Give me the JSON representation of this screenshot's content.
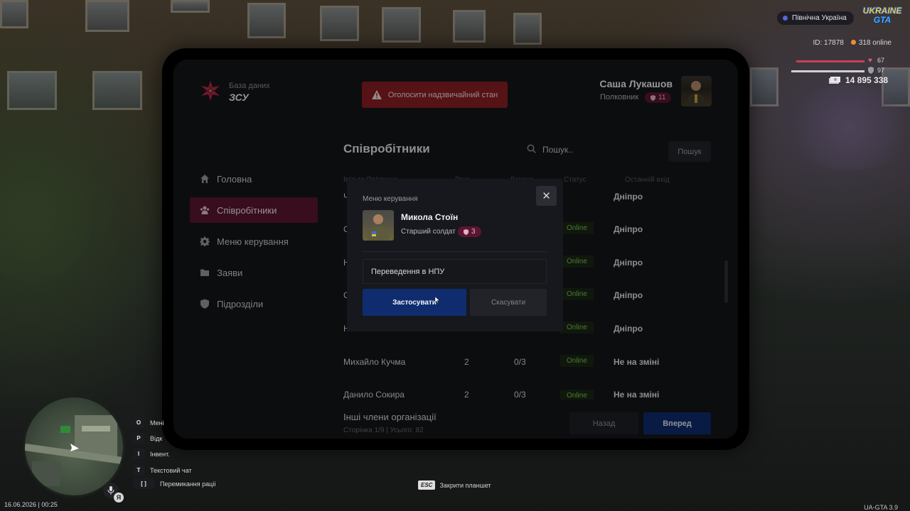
{
  "tablet": {
    "db_label": "База даних",
    "org_name": "ЗСУ",
    "alert_button": "Оголосити надзвичайний стан",
    "user": {
      "name": "Саша Лукашов",
      "rank": "Полковник",
      "level": "11"
    },
    "nav": [
      {
        "label": "Головна",
        "icon": "home-icon",
        "active": false
      },
      {
        "label": "Співробітники",
        "icon": "users-icon",
        "active": true
      },
      {
        "label": "Меню керування",
        "icon": "gear-icon",
        "active": false
      },
      {
        "label": "Заяви",
        "icon": "folder-icon",
        "active": false
      },
      {
        "label": "Підрозділи",
        "icon": "shield-icon",
        "active": false
      }
    ],
    "section_title": "Співробітники",
    "search": {
      "placeholder": "Пошук..",
      "button": "Пошук"
    },
    "table": {
      "headers": [
        "Ім'я та Прізвище",
        "Ранг",
        "Догани",
        "Статус",
        "Останній вхід"
      ],
      "rows": [
        {
          "name": "Ч",
          "rank": "",
          "warnings": "",
          "status": "",
          "last": "Дніпро"
        },
        {
          "name": "С",
          "rank": "",
          "warnings": "",
          "status": "Online",
          "last": "Дніпро"
        },
        {
          "name": "Н",
          "rank": "",
          "warnings": "",
          "status": "Online",
          "last": "Дніпро"
        },
        {
          "name": "С",
          "rank": "",
          "warnings": "",
          "status": "Online",
          "last": "Дніпро"
        },
        {
          "name": "Н",
          "rank": "",
          "warnings": "",
          "status": "Online",
          "last": "Дніпро"
        },
        {
          "name": "Михайло Кучма",
          "rank": "2",
          "warnings": "0/3",
          "status": "Online",
          "last": "Не на зміні"
        },
        {
          "name": "Данило Сокира",
          "rank": "2",
          "warnings": "0/3",
          "status": "Online",
          "last": "Не на зміні"
        }
      ]
    },
    "other_members": "Інші члени організації",
    "page_info": "Сторінка 1/9 | Усього: 82",
    "back_button": "Назад",
    "next_button": "Вперед"
  },
  "modal": {
    "title": "Меню керування",
    "close": "✕",
    "member": {
      "name": "Микола Стоїн",
      "rank": "Старший солдат",
      "level": "3"
    },
    "action": "Переведення в НПУ",
    "apply": "Застосувати",
    "cancel": "Скасувати"
  },
  "hud": {
    "server": "Північна Україна",
    "brand_top": "UKRAINE",
    "brand_bottom": "GTA",
    "player_id": "ID: 17878",
    "online": "318 online",
    "health": "67",
    "armor": "97",
    "health_level": 0.67,
    "armor_level": 0.97,
    "money": "14 895 338",
    "hints": [
      {
        "key": "O",
        "label": "Мені"
      },
      {
        "key": "P",
        "label": "Відк"
      },
      {
        "key": "I",
        "label": "Інвент."
      },
      {
        "key": "T",
        "label": "Текстовий чат"
      },
      {
        "key": "[ ]",
        "label": "Перемикання раціі"
      }
    ],
    "mic_badge": "Я",
    "datetime": "16.06.2026 | 00:25",
    "esc_key": "ESC",
    "esc_label": "Закрити планшет",
    "version": "UA-GTA 3.9"
  },
  "colors": {
    "accent": "#5b1530",
    "primary_button": "#0f2d6e",
    "alert": "#8a1f25",
    "online": "#7cc352"
  }
}
